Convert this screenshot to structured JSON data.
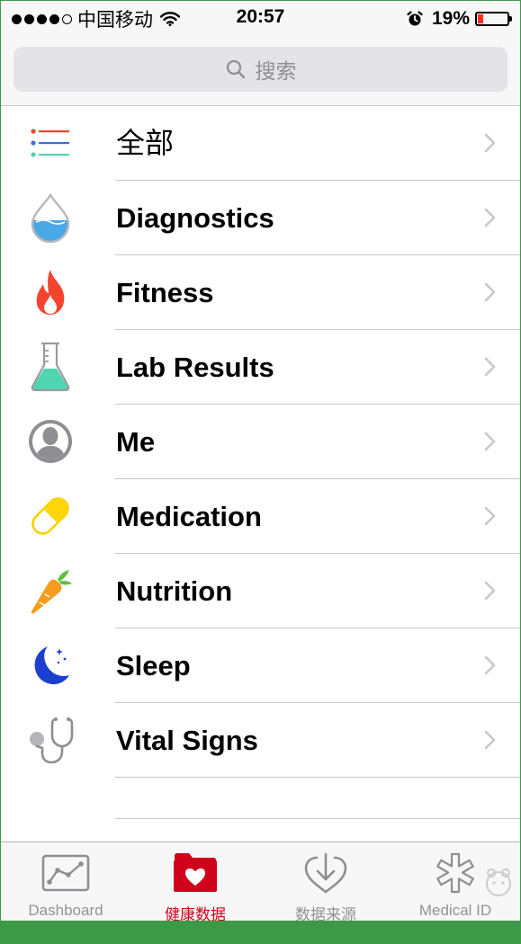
{
  "status_bar": {
    "carrier": "中国移动",
    "time": "20:57",
    "battery_percent": "19%",
    "battery_level": 0.19,
    "signal_bars": 4,
    "signal_total": 5
  },
  "search": {
    "placeholder": "搜索",
    "icon": "search-icon"
  },
  "categories": [
    {
      "label": "全部",
      "icon": "list-icon"
    },
    {
      "label": "Diagnostics",
      "icon": "droplet-icon"
    },
    {
      "label": "Fitness",
      "icon": "flame-icon"
    },
    {
      "label": "Lab Results",
      "icon": "flask-icon"
    },
    {
      "label": "Me",
      "icon": "person-icon"
    },
    {
      "label": "Medication",
      "icon": "pill-icon"
    },
    {
      "label": "Nutrition",
      "icon": "carrot-icon"
    },
    {
      "label": "Sleep",
      "icon": "moon-icon"
    },
    {
      "label": "Vital Signs",
      "icon": "stethoscope-icon"
    }
  ],
  "tabs": [
    {
      "label": "Dashboard",
      "icon": "dashboard-chart-icon",
      "active": false
    },
    {
      "label": "健康数据",
      "icon": "heart-folder-icon",
      "active": true
    },
    {
      "label": "数据来源",
      "icon": "download-heart-icon",
      "active": false
    },
    {
      "label": "Medical ID",
      "icon": "medical-star-icon",
      "active": false
    }
  ],
  "colors": {
    "accent": "#d0021b",
    "tab_inactive": "#929292",
    "separator": "#c8c7cc",
    "frame_green": "#3c9a46",
    "battery_low": "#ff2d1f"
  }
}
